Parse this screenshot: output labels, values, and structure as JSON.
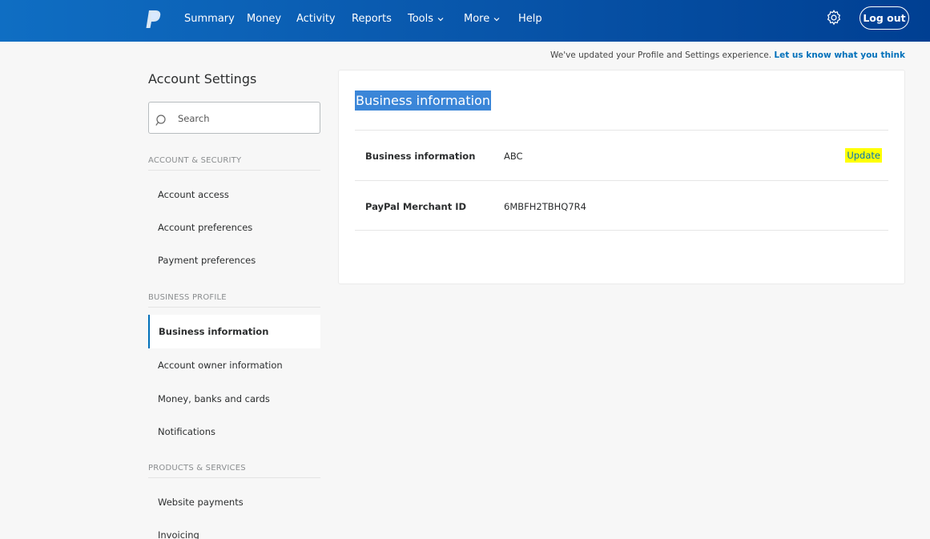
{
  "header": {
    "nav": [
      {
        "label": "Summary",
        "dropdown": false
      },
      {
        "label": "Money",
        "dropdown": false
      },
      {
        "label": "Activity",
        "dropdown": false
      },
      {
        "label": "Reports",
        "dropdown": false
      },
      {
        "label": "Tools",
        "dropdown": true
      },
      {
        "label": "More",
        "dropdown": true
      },
      {
        "label": "Help",
        "dropdown": false
      }
    ],
    "logout_label": "Log out"
  },
  "notice": {
    "text": "We've updated your Profile and Settings experience.",
    "link": "Let us know what you think"
  },
  "sidebar": {
    "title": "Account Settings",
    "search_placeholder": "Search",
    "sections": [
      {
        "heading": "ACCOUNT & SECURITY",
        "items": [
          "Account access",
          "Account preferences",
          "Payment preferences"
        ]
      },
      {
        "heading": "BUSINESS PROFILE",
        "items": [
          "Business information",
          "Account owner information",
          "Money, banks and cards",
          "Notifications"
        ]
      },
      {
        "heading": "PRODUCTS & SERVICES",
        "items": [
          "Website payments",
          "Invoicing"
        ]
      }
    ],
    "active_item": "Business information"
  },
  "main": {
    "title": "Business information",
    "rows": [
      {
        "label": "Business information",
        "value": "ABC",
        "action": "Update"
      },
      {
        "label": "PayPal Merchant ID",
        "value": "6MBFH2TBHQ7R4"
      }
    ]
  },
  "colors": {
    "brand_blue": "#0070ba",
    "nav_gradient_start": "#0f6ec3",
    "nav_gradient_end": "#003f92",
    "highlight_yellow": "#ffff00",
    "title_selection": "#3b86d8"
  }
}
